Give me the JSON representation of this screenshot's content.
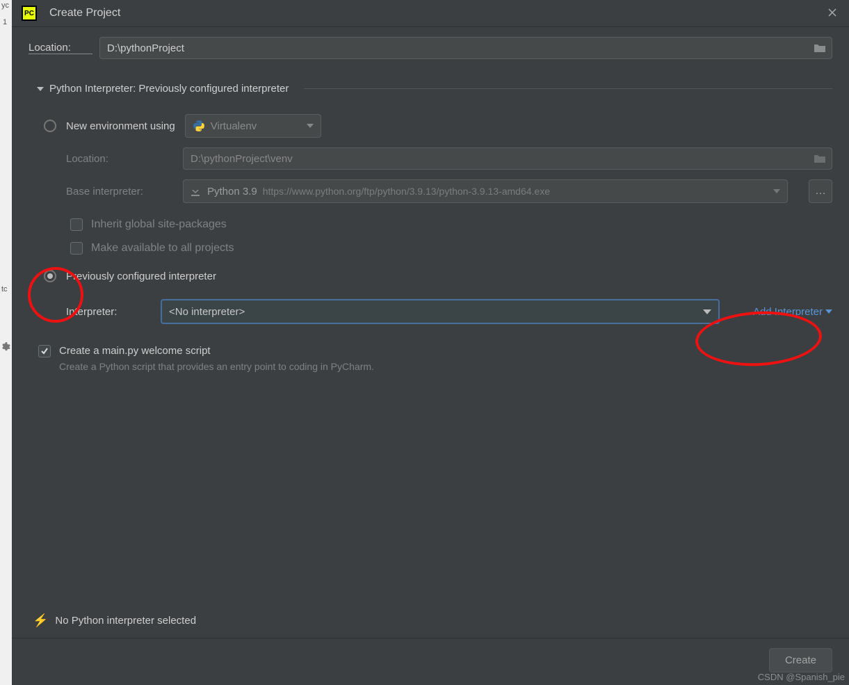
{
  "leftstrip": {
    "top": "yc",
    "num": "1",
    "bottom": "tc"
  },
  "titlebar": {
    "title": "Create Project",
    "app_icon_text": "PC"
  },
  "location": {
    "label": "Location:",
    "value": "D:\\pythonProject"
  },
  "section": {
    "title": "Python Interpreter: Previously configured interpreter"
  },
  "new_env": {
    "radio_label": "New environment using",
    "dropdown": "Virtualenv",
    "loc_label": "Location:",
    "loc_value": "D:\\pythonProject\\venv",
    "base_label": "Base interpreter:",
    "base_value_main": "Python 3.9",
    "base_value_sub": "https://www.python.org/ftp/python/3.9.13/python-3.9.13-amd64.exe",
    "chk_inherit": "Inherit global site-packages",
    "chk_make_avail": "Make available to all projects"
  },
  "prev": {
    "radio_label": "Previously configured interpreter",
    "int_label": "Interpreter:",
    "int_value": "<No interpreter>",
    "add_link": "Add Interpreter"
  },
  "welcome": {
    "chk_label": "Create a main.py welcome script",
    "sub": "Create a Python script that provides an entry point to coding in PyCharm."
  },
  "warning": "No Python interpreter selected",
  "buttons": {
    "create": "Create"
  },
  "watermark": "CSDN @Spanish_pie"
}
